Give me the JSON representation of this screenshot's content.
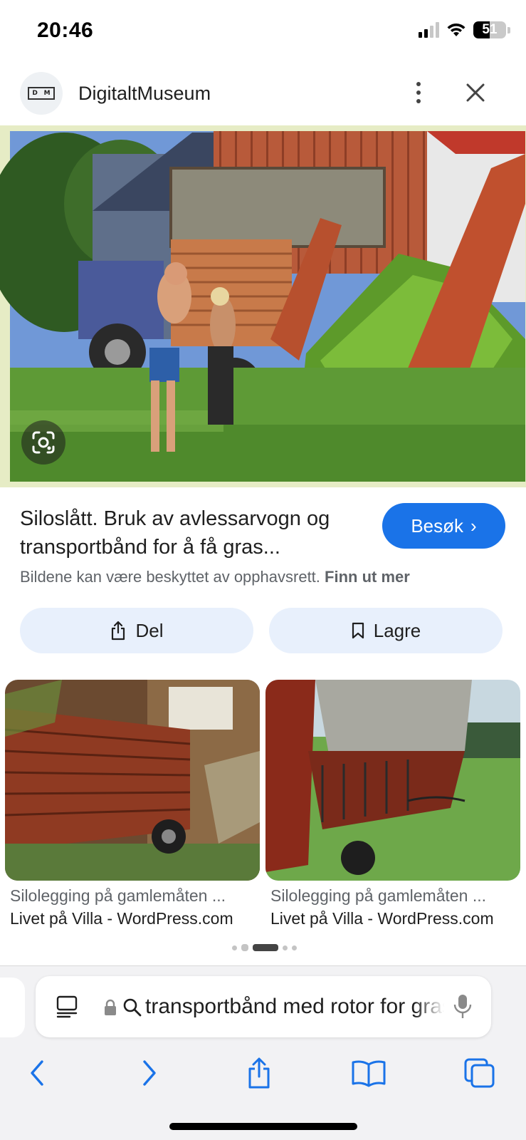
{
  "status_bar": {
    "time": "20:46",
    "battery": "51",
    "battery_fraction": 0.51
  },
  "header": {
    "logo_letters": [
      "D",
      "M"
    ],
    "site_name": "DigitaltMuseum",
    "icons": [
      "more-vert-icon",
      "close-icon"
    ]
  },
  "hero": {
    "lens_icon": "google-lens-icon"
  },
  "result": {
    "title": "Siloslått. Bruk av avlessarvogn og transportbånd for å få gras...",
    "visit_label": "Besøk",
    "visit_chevron": "›",
    "copyright_text": "Bildene kan være beskyttet av opphavsrett.",
    "learn_more": "Finn ut mer"
  },
  "actions": {
    "share_label": "Del",
    "save_label": "Lagre"
  },
  "related": [
    {
      "title": "Silolegging på gamlemåten ...",
      "source": "Livet på Villa - WordPress.com"
    },
    {
      "title": "Silolegging på gamlemåten ...",
      "source": "Livet på Villa - WordPress.com"
    }
  ],
  "pager": {
    "count": 5,
    "active_index": 2
  },
  "toolbar": {
    "address_text": "transportbånd med rotor for gras",
    "icons": [
      "reader-icon",
      "lock-icon",
      "search-icon",
      "microphone-icon",
      "back-icon",
      "forward-icon",
      "share-icon",
      "bookmarks-icon",
      "tabs-icon"
    ]
  },
  "colors": {
    "accent": "#1a73e8",
    "action_bg": "#e8f0fc",
    "secondary_text": "#5f6368"
  }
}
